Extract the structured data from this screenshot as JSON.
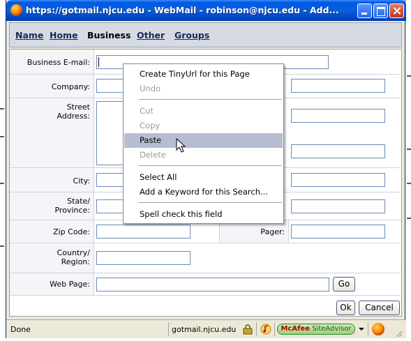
{
  "window": {
    "title": "https://gotmail.njcu.edu - WebMail - robinson@njcu.edu - Add...",
    "icon": "firefox-icon"
  },
  "tabs": [
    {
      "label": "Name",
      "active": false
    },
    {
      "label": "Home",
      "active": false
    },
    {
      "label": "Business",
      "active": true
    },
    {
      "label": "Other",
      "active": false
    },
    {
      "label": "Groups",
      "active": false
    }
  ],
  "form": {
    "business_email_label": "Business E-mail:",
    "business_email_value": "",
    "company_label": "Company:",
    "street_label_1": "Street",
    "street_label_2": "Address:",
    "city_label": "City:",
    "state_label_1": "State/",
    "state_label_2": "Province:",
    "zip_label": "Zip Code:",
    "pager_label": "Pager:",
    "country_label_1": "Country/",
    "country_label_2": "Region:",
    "webpage_label": "Web Page:",
    "go_label": "Go",
    "ok_label": "Ok",
    "cancel_label": "Cancel"
  },
  "context_menu": {
    "items": [
      {
        "label": "Create TinyUrl for this Page",
        "disabled": false
      },
      {
        "label": "Undo",
        "disabled": true
      },
      {
        "label": "Cut",
        "disabled": true
      },
      {
        "label": "Copy",
        "disabled": true
      },
      {
        "label": "Paste",
        "disabled": false,
        "highlighted": true
      },
      {
        "label": "Delete",
        "disabled": true
      },
      {
        "label": "Select All",
        "disabled": false
      },
      {
        "label": "Add a Keyword for this Search...",
        "disabled": false
      },
      {
        "label": "Spell check this field",
        "disabled": false
      }
    ]
  },
  "statusbar": {
    "status": "Done",
    "domain": "gotmail.njcu.edu",
    "siteadvisor_brand": "McAfee",
    "siteadvisor_product": "SiteAdvisor"
  },
  "colors": {
    "titlebar": "#0058e6",
    "highlight": "#b6bdd2",
    "siteadvisor_green": "#9ed07a"
  }
}
